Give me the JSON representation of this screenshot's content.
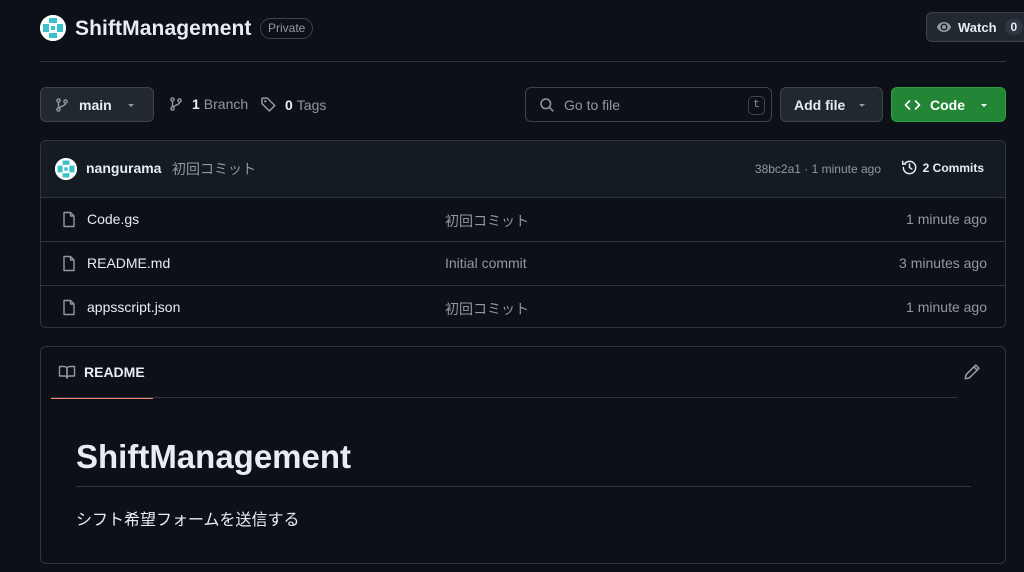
{
  "header": {
    "repo_name": "ShiftManagement",
    "visibility_badge": "Private",
    "watch_label": "Watch",
    "watch_count": "0"
  },
  "toolbar": {
    "branch_name": "main",
    "branch_count": "1",
    "branch_label": "Branch",
    "tag_count": "0",
    "tag_label": "Tags",
    "search_placeholder": "Go to file",
    "search_shortcut": "t",
    "add_file_label": "Add file",
    "code_label": "Code"
  },
  "latest_commit": {
    "author": "nangurama",
    "message": "初回コミット",
    "hash_and_time": "38bc2a1 · 1 minute ago",
    "commits_label": "2 Commits"
  },
  "files": [
    {
      "name": "Code.gs",
      "message": "初回コミット",
      "time": "1 minute ago"
    },
    {
      "name": "README.md",
      "message": "Initial commit",
      "time": "3 minutes ago"
    },
    {
      "name": "appsscript.json",
      "message": "初回コミット",
      "time": "1 minute ago"
    }
  ],
  "readme": {
    "tab_label": "README",
    "heading": "ShiftManagement",
    "body": "シフト希望フォームを送信する"
  },
  "colors": {
    "background": "#0d1117",
    "border": "#30363d",
    "code_button": "#238636",
    "readme_tab_accent": "#f78166",
    "muted_text": "#9198a1"
  },
  "icons": [
    "eye-icon",
    "git-branch-icon",
    "tag-icon",
    "search-icon",
    "caret-down-icon",
    "code-icon",
    "history-icon",
    "file-icon",
    "book-icon",
    "pencil-icon"
  ]
}
